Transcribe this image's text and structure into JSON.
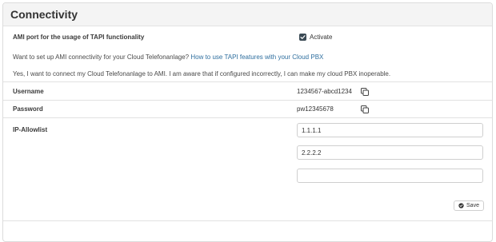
{
  "card": {
    "title": "Connectivity"
  },
  "ami": {
    "label": "AMI port for the usage of TAPI functionality",
    "checkbox_label": "Activate",
    "checked": true,
    "setup_prompt": "Want to set up AMI connectivity for your Cloud Telefonanlage?",
    "setup_link": "How to use TAPI features with your Cloud PBX",
    "consent_text": "Yes, I want to connect my Cloud Telefonanlage to AMI. I am aware that if configured incorrectly, I can make my cloud PBX inoperable."
  },
  "credentials": {
    "username_label": "Username",
    "username_value": "1234567-abcd1234",
    "password_label": "Password",
    "password_value": "pw12345678"
  },
  "allowlist": {
    "label": "IP-Allowlist",
    "entries": [
      "1.1.1.1",
      "2.2.2.2",
      ""
    ]
  },
  "actions": {
    "save_label": "Save"
  },
  "colors": {
    "link": "#2f6f9f",
    "checkbox": "#3b4a55",
    "header_bg": "#f4f4f4"
  },
  "icons": {
    "copy": "copy-icon",
    "save": "check-circle-icon",
    "checkbox": "check-icon"
  }
}
